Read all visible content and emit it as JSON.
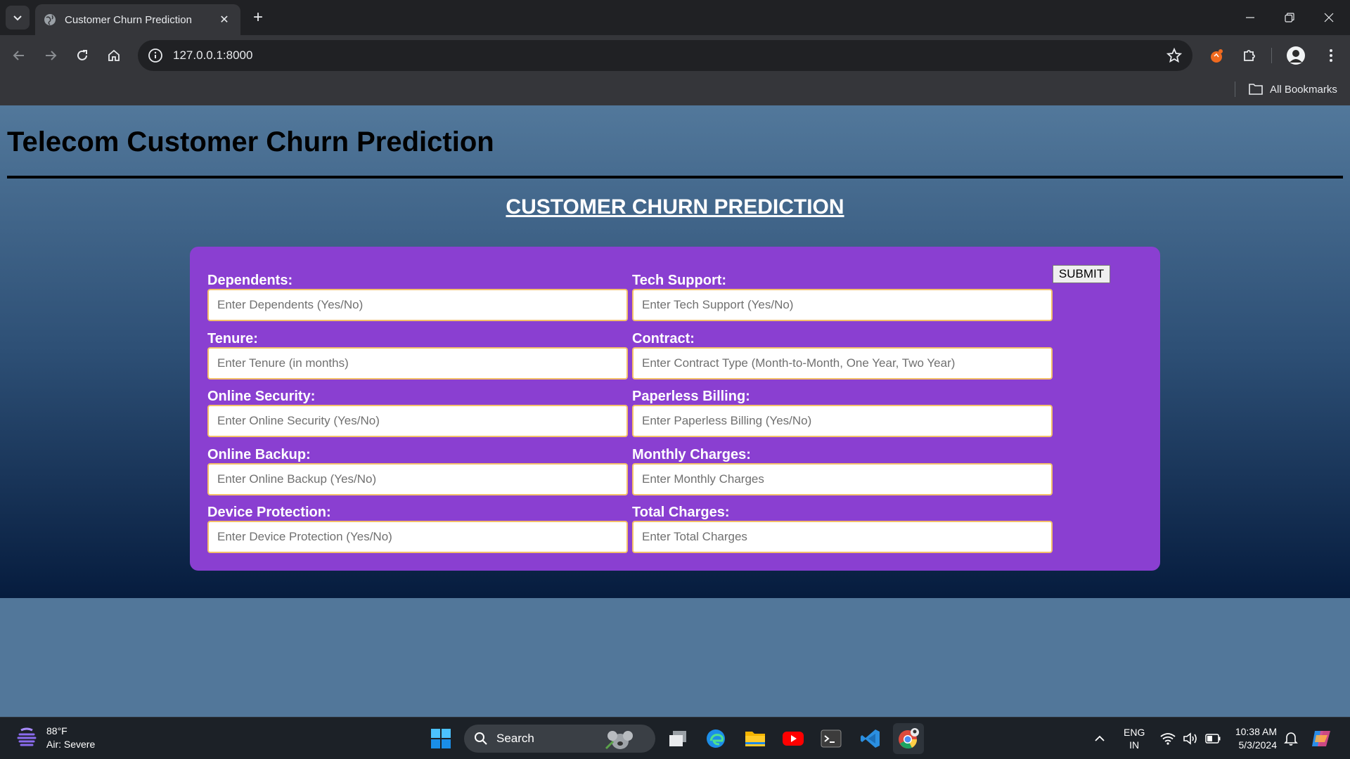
{
  "browser": {
    "tab_title": "Customer Churn Prediction",
    "url": "127.0.0.1:8000",
    "all_bookmarks_label": "All Bookmarks"
  },
  "page": {
    "header_title": "Telecom Customer Churn Prediction",
    "section_title": "CUSTOMER CHURN PREDICTION",
    "submit_label": "SUBMIT",
    "fields": [
      {
        "label": "Dependents:",
        "placeholder": "Enter Dependents (Yes/No)",
        "value": ""
      },
      {
        "label": "Tech Support:",
        "placeholder": "Enter Tech Support (Yes/No)",
        "value": ""
      },
      {
        "label": "Tenure:",
        "placeholder": "Enter Tenure (in months)",
        "value": ""
      },
      {
        "label": "Contract:",
        "placeholder": "Enter Contract Type (Month-to-Month, One Year, Two Year)",
        "value": ""
      },
      {
        "label": "Online Security:",
        "placeholder": "Enter Online Security (Yes/No)",
        "value": ""
      },
      {
        "label": "Paperless Billing:",
        "placeholder": "Enter Paperless Billing (Yes/No)",
        "value": ""
      },
      {
        "label": "Online Backup:",
        "placeholder": "Enter Online Backup (Yes/No)",
        "value": ""
      },
      {
        "label": "Monthly Charges:",
        "placeholder": "Enter Monthly Charges",
        "value": ""
      },
      {
        "label": "Device Protection:",
        "placeholder": "Enter Device Protection (Yes/No)",
        "value": ""
      },
      {
        "label": "Total Charges:",
        "placeholder": "Enter Total Charges",
        "value": ""
      }
    ]
  },
  "taskbar": {
    "weather_temp": "88°F",
    "weather_desc": "Air: Severe",
    "search_label": "Search",
    "lang_primary": "ENG",
    "lang_secondary": "IN",
    "time": "10:38 AM",
    "date": "5/3/2024"
  },
  "colors": {
    "form_card": "#8a3fd1",
    "input_border": "#f4c06a",
    "page_gradient_top": "#52789b",
    "page_gradient_bottom": "#061c3e"
  }
}
